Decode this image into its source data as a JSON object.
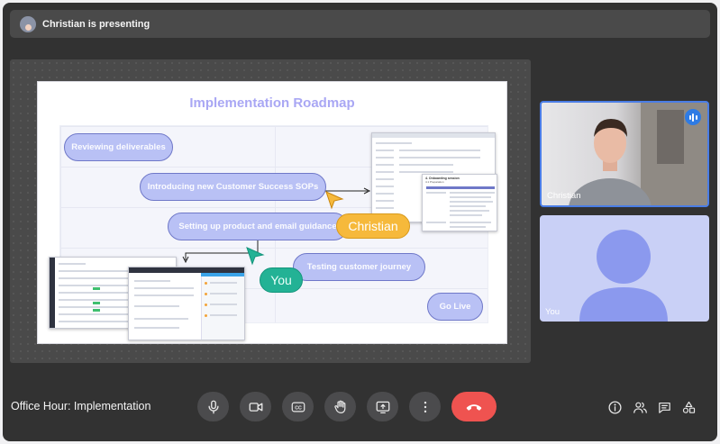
{
  "topbar": {
    "presenting_text": "Christian is presenting"
  },
  "slide": {
    "title": "Implementation Roadmap",
    "steps": [
      {
        "label": "Reviewing deliverables"
      },
      {
        "label": "Introducing new Customer Success SOPs"
      },
      {
        "label": "Setting up product and email guidance"
      },
      {
        "label": "Testing customer journey"
      },
      {
        "label": "Go Live"
      }
    ],
    "cursors": {
      "christian": "Christian",
      "you": "You"
    },
    "doc_heading": "4. Onboarding session",
    "doc_subheading": "4.1 Preparation"
  },
  "participants": [
    {
      "name": "Christian",
      "speaking": true
    },
    {
      "name": "You",
      "speaking": false
    }
  ],
  "meeting": {
    "title": "Office Hour: Implementation"
  },
  "controls": [
    {
      "name": "microphone"
    },
    {
      "name": "camera"
    },
    {
      "name": "captions",
      "glyph": "CC"
    },
    {
      "name": "raise-hand"
    },
    {
      "name": "share-screen"
    },
    {
      "name": "more-options"
    },
    {
      "name": "leave-call"
    }
  ],
  "right_controls": [
    "info",
    "participants",
    "chat",
    "activities"
  ],
  "colors": {
    "leave": "#ef5350",
    "speaking_border": "#4a7de6",
    "christian_cursor": "#f6b93b",
    "you_cursor": "#23b295",
    "step_pill": "#b9c1f5"
  }
}
